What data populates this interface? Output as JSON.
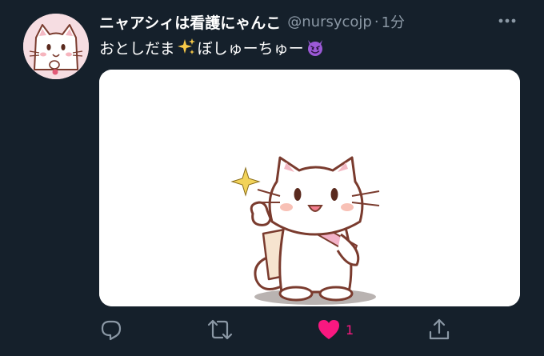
{
  "tweet": {
    "display_name": "ニャアシィは看護にゃんこ",
    "handle": "@nursycojp",
    "separator": "·",
    "time": "1分",
    "text_part1": "おとしだま",
    "text_part2": "ぼしゅーちゅー",
    "emoji_1": "sparkles-emoji",
    "emoji_2": "smiling-devil-emoji",
    "media_description_icon": "white-cat-thumbs-up-illustration"
  },
  "actions": {
    "reply_icon": "reply-icon",
    "retweet_icon": "retweet-icon",
    "like_icon": "heart-icon",
    "like_count": "1",
    "share_icon": "share-icon"
  },
  "colors": {
    "background": "#15202b",
    "muted_text": "#8b98a5",
    "like_accent": "#f91880",
    "icon_gray": "#8b98a5"
  }
}
